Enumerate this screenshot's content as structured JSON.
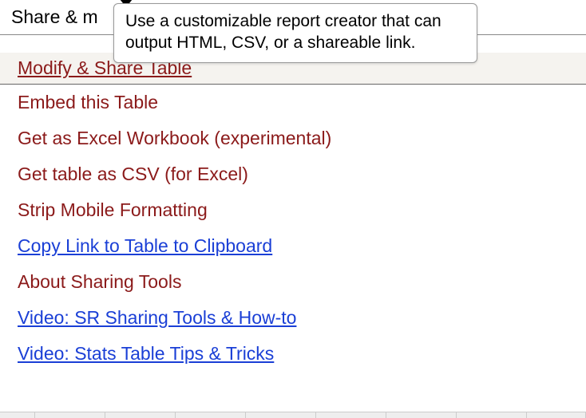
{
  "header": {
    "title": "Share & m"
  },
  "tooltip": {
    "text": "Use a customizable report creator that can output HTML, CSV, or a shareable link."
  },
  "menu": {
    "items": [
      {
        "label": "Modify & Share Table",
        "style": "maroon",
        "active": true
      },
      {
        "label": "Embed this Table",
        "style": "maroon",
        "active": false
      },
      {
        "label": "Get as Excel Workbook (experimental)",
        "style": "maroon",
        "active": false
      },
      {
        "label": "Get table as CSV (for Excel)",
        "style": "maroon",
        "active": false
      },
      {
        "label": "Strip Mobile Formatting",
        "style": "maroon",
        "active": false
      },
      {
        "label": "Copy Link to Table to Clipboard",
        "style": "bluelink",
        "active": false
      },
      {
        "label": "About Sharing Tools",
        "style": "maroon",
        "active": false
      },
      {
        "label": "Video: SR Sharing Tools & How-to",
        "style": "bluelink",
        "active": false
      },
      {
        "label": "Video: Stats Table Tips & Tricks",
        "style": "bluelink",
        "active": false
      }
    ]
  }
}
